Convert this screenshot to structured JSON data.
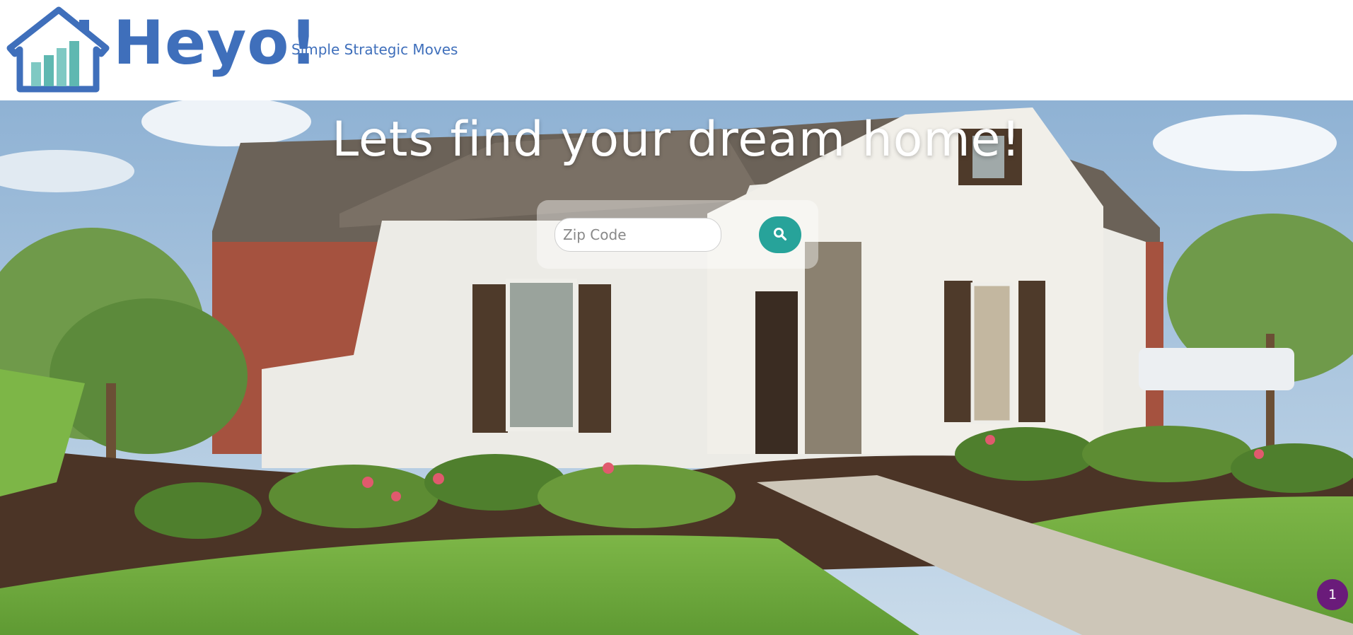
{
  "brand": {
    "name": "Heyo!",
    "tagline": "Simple Strategic Moves",
    "color": "#3f6fbb",
    "accent_bars": "#7fc9c3",
    "logo_icon": "house-chart-icon"
  },
  "hero": {
    "headline": "Lets find your dream home!",
    "background": "house-photo"
  },
  "search": {
    "placeholder": "Zip Code",
    "value": "",
    "button_icon": "search-icon",
    "button_color": "#27a39a"
  },
  "notification": {
    "count": "1",
    "color": "#6a1b7a"
  }
}
